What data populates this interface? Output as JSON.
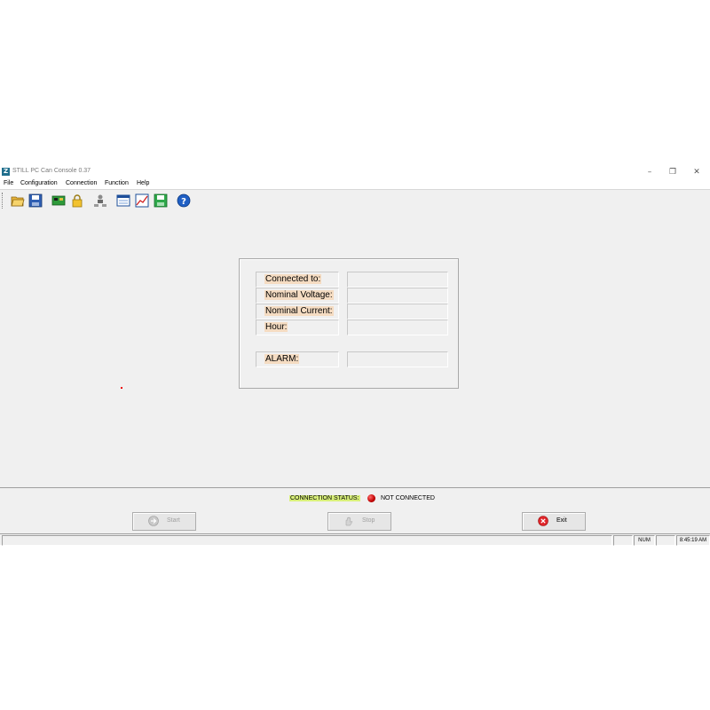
{
  "window": {
    "title": "STILL PC Can Console 0.37",
    "app_icon_letter": "Z",
    "controls": [
      "–",
      "❐",
      "✕"
    ]
  },
  "menu": [
    "File",
    "Configuration",
    "Connection",
    "Function",
    "Help"
  ],
  "toolbar": {
    "buttons": [
      "open-folder-icon",
      "save-icon",
      "can-card-icon",
      "lock-icon",
      "network-icon",
      "window-icon",
      "chart-icon",
      "green-save-icon",
      "help-icon"
    ],
    "help_glyph": "?"
  },
  "info_panel": {
    "connected_to": {
      "label": "Connected to:",
      "value": ""
    },
    "nominal_voltage": {
      "label": "Nominal Voltage:",
      "value": ""
    },
    "nominal_current": {
      "label": "Nominal Current:",
      "value": ""
    },
    "hour": {
      "label": "Hour:",
      "value": ""
    },
    "alarm": {
      "label": "ALARM:",
      "value": ""
    }
  },
  "connection": {
    "label": "CONNECTION STATUS:",
    "status": "NOT CONNECTED",
    "status_color": "#c00000",
    "label_highlight": "#d9f07a"
  },
  "buttons": {
    "start": "Start",
    "stop": "Stop",
    "exit": "Exit"
  },
  "statusbar": {
    "num": "NUM",
    "time": "8:45:19 AM"
  }
}
